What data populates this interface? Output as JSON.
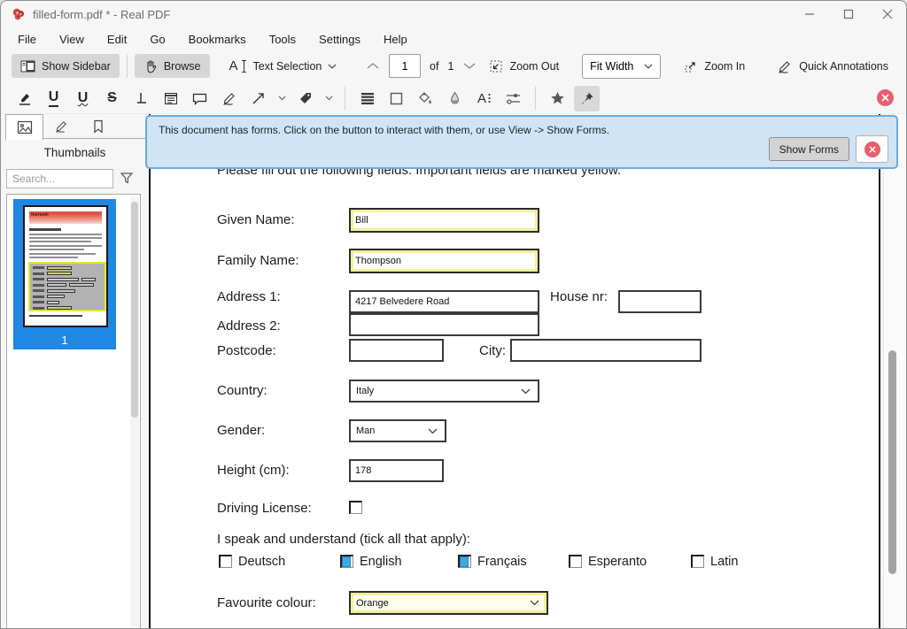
{
  "window": {
    "title": "filled-form.pdf * - Real PDF"
  },
  "menu": {
    "items": [
      "File",
      "View",
      "Edit",
      "Go",
      "Bookmarks",
      "Tools",
      "Settings",
      "Help"
    ]
  },
  "toolbar": {
    "show_sidebar": "Show Sidebar",
    "browse": "Browse",
    "text_selection": "Text Selection",
    "page_current": "1",
    "of_label": "of",
    "page_total": "1",
    "zoom_out": "Zoom Out",
    "fit_width": "Fit Width",
    "zoom_in": "Zoom In",
    "quick_annotations": "Quick Annotations"
  },
  "icons": {
    "underline_glyph": "U",
    "squiggly_glyph": "U",
    "strikeout_glyph": "S",
    "text_select_glyph": "A",
    "font_glyph": "A"
  },
  "sidebar": {
    "title": "Thumbnails",
    "search_placeholder": "Search...",
    "thumbnail": {
      "logo_text": "foersom",
      "page_label": "1"
    }
  },
  "notification": {
    "message": "This document has forms. Click on the button to interact with them, or use View -> Show Forms.",
    "show_forms_label": "Show Forms"
  },
  "document": {
    "heading": "Please fill out the following fields. Important fields are marked yellow.",
    "fields": {
      "given_name": {
        "label": "Given Name:",
        "value": "Bill",
        "important": true
      },
      "family_name": {
        "label": "Family Name:",
        "value": "Thompson",
        "important": true
      },
      "address1": {
        "label": "Address 1:",
        "value": "4217 Belvedere Road"
      },
      "house_nr": {
        "label": "House nr:",
        "value": ""
      },
      "address2": {
        "label": "Address 2:",
        "value": ""
      },
      "postcode": {
        "label": "Postcode:",
        "value": ""
      },
      "city": {
        "label": "City:",
        "value": ""
      },
      "country": {
        "label": "Country:",
        "value": "Italy"
      },
      "gender": {
        "label": "Gender:",
        "value": "Man"
      },
      "height_cm": {
        "label": "Height (cm):",
        "value": "178"
      },
      "driving_license": {
        "label": "Driving License:",
        "checked": false
      },
      "languages": {
        "label": "I speak and understand (tick all that apply):",
        "options": [
          {
            "label": "Deutsch",
            "checked": false
          },
          {
            "label": "English",
            "checked": true
          },
          {
            "label": "Français",
            "checked": true
          },
          {
            "label": "Esperanto",
            "checked": false
          },
          {
            "label": "Latin",
            "checked": false
          }
        ]
      },
      "favourite_colour": {
        "label": "Favourite colour:",
        "value": "Orange",
        "important": true
      }
    }
  },
  "colors": {
    "selection_blue": "#2087e2",
    "notification_bg": "#cfe4f4",
    "notification_border": "#6cabdb",
    "important_field_yellow": "#f0f09c",
    "close_red": "#e4616e",
    "checkbox_checked_blue": "#3fa9e2",
    "thumbnail_banner_red": "#df5244"
  }
}
